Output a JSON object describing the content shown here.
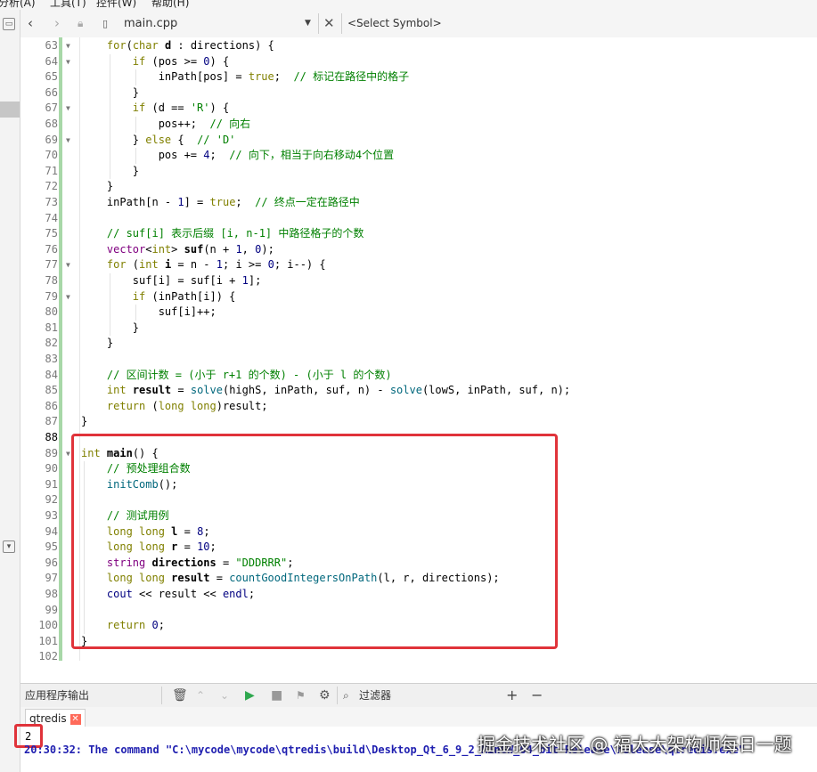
{
  "menu": [
    "分析(A)",
    "工具(T)",
    "控件(W)",
    "帮助(H)"
  ],
  "toolbar": {
    "file_name": "main.cpp",
    "symbol_placeholder": "<Select Symbol>"
  },
  "code_lines": [
    {
      "n": "63",
      "fold": true,
      "indent": 1,
      "tokens": [
        [
          "kw",
          "for"
        ],
        [
          "",
          "("
        ],
        [
          "kw",
          "char"
        ],
        [
          "",
          " "
        ],
        [
          "bd",
          "d"
        ],
        [
          "",
          " : directions) {"
        ]
      ]
    },
    {
      "n": "64",
      "fold": true,
      "indent": 2,
      "tokens": [
        [
          "kw",
          "if"
        ],
        [
          "",
          " (pos >= "
        ],
        [
          "nm",
          "0"
        ],
        [
          "",
          ") {"
        ]
      ]
    },
    {
      "n": "65",
      "fold": false,
      "indent": 3,
      "tokens": [
        [
          "",
          "inPath[pos] = "
        ],
        [
          "kw",
          "true"
        ],
        [
          "",
          ";  "
        ],
        [
          "cm",
          "// 标记在路径中的格子"
        ]
      ]
    },
    {
      "n": "66",
      "fold": false,
      "indent": 2,
      "tokens": [
        [
          "",
          "}"
        ]
      ]
    },
    {
      "n": "67",
      "fold": true,
      "indent": 2,
      "tokens": [
        [
          "kw",
          "if"
        ],
        [
          "",
          " (d == "
        ],
        [
          "st",
          "'R'"
        ],
        [
          "",
          ") {"
        ]
      ]
    },
    {
      "n": "68",
      "fold": false,
      "indent": 3,
      "tokens": [
        [
          "",
          "pos++;  "
        ],
        [
          "cm",
          "// 向右"
        ]
      ]
    },
    {
      "n": "69",
      "fold": true,
      "indent": 2,
      "tokens": [
        [
          "",
          "} "
        ],
        [
          "kw",
          "else"
        ],
        [
          "",
          " {  "
        ],
        [
          "cm",
          "// 'D'"
        ]
      ]
    },
    {
      "n": "70",
      "fold": false,
      "indent": 3,
      "tokens": [
        [
          "",
          "pos += "
        ],
        [
          "nm",
          "4"
        ],
        [
          "",
          ";  "
        ],
        [
          "cm",
          "// 向下，相当于向右移动4个位置"
        ]
      ]
    },
    {
      "n": "71",
      "fold": false,
      "indent": 2,
      "tokens": [
        [
          "",
          "}"
        ]
      ]
    },
    {
      "n": "72",
      "fold": false,
      "indent": 1,
      "tokens": [
        [
          "",
          "}"
        ]
      ]
    },
    {
      "n": "73",
      "fold": false,
      "indent": 1,
      "tokens": [
        [
          "",
          "inPath[n - "
        ],
        [
          "nm",
          "1"
        ],
        [
          "",
          "] = "
        ],
        [
          "kw",
          "true"
        ],
        [
          "",
          ";  "
        ],
        [
          "cm",
          "// 终点一定在路径中"
        ]
      ]
    },
    {
      "n": "74",
      "fold": false,
      "indent": 0,
      "tokens": []
    },
    {
      "n": "75",
      "fold": false,
      "indent": 1,
      "tokens": [
        [
          "cm",
          "// suf[i] 表示后缀 [i, n-1] 中路径格子的个数"
        ]
      ]
    },
    {
      "n": "76",
      "fold": false,
      "indent": 1,
      "tokens": [
        [
          "ty",
          "vector"
        ],
        [
          "",
          "<"
        ],
        [
          "kw",
          "int"
        ],
        [
          "",
          "> "
        ],
        [
          "bd",
          "suf"
        ],
        [
          "",
          "(n + "
        ],
        [
          "nm",
          "1"
        ],
        [
          "",
          ", "
        ],
        [
          "nm",
          "0"
        ],
        [
          "",
          ");"
        ]
      ]
    },
    {
      "n": "77",
      "fold": true,
      "indent": 1,
      "tokens": [
        [
          "kw",
          "for"
        ],
        [
          "",
          " ("
        ],
        [
          "kw",
          "int"
        ],
        [
          "",
          " "
        ],
        [
          "bd",
          "i"
        ],
        [
          "",
          " = n - "
        ],
        [
          "nm",
          "1"
        ],
        [
          "",
          "; i >= "
        ],
        [
          "nm",
          "0"
        ],
        [
          "",
          "; i--) {"
        ]
      ]
    },
    {
      "n": "78",
      "fold": false,
      "indent": 2,
      "tokens": [
        [
          "",
          "suf[i] = suf[i + "
        ],
        [
          "nm",
          "1"
        ],
        [
          "",
          "];"
        ]
      ]
    },
    {
      "n": "79",
      "fold": true,
      "indent": 2,
      "tokens": [
        [
          "kw",
          "if"
        ],
        [
          "",
          " (inPath[i]) {"
        ]
      ]
    },
    {
      "n": "80",
      "fold": false,
      "indent": 3,
      "tokens": [
        [
          "",
          "suf[i]++;"
        ]
      ]
    },
    {
      "n": "81",
      "fold": false,
      "indent": 2,
      "tokens": [
        [
          "",
          "}"
        ]
      ]
    },
    {
      "n": "82",
      "fold": false,
      "indent": 1,
      "tokens": [
        [
          "",
          "}"
        ]
      ]
    },
    {
      "n": "83",
      "fold": false,
      "indent": 0,
      "tokens": []
    },
    {
      "n": "84",
      "fold": false,
      "indent": 1,
      "tokens": [
        [
          "cm",
          "// 区间计数 = (小于 r+1 的个数) - (小于 l 的个数)"
        ]
      ]
    },
    {
      "n": "85",
      "fold": false,
      "indent": 1,
      "tokens": [
        [
          "kw",
          "int"
        ],
        [
          "",
          " "
        ],
        [
          "bd",
          "result"
        ],
        [
          "",
          " = "
        ],
        [
          "fn",
          "solve"
        ],
        [
          "",
          "(highS, inPath, suf, n) - "
        ],
        [
          "fn",
          "solve"
        ],
        [
          "",
          "(lowS, inPath, suf, n);"
        ]
      ]
    },
    {
      "n": "86",
      "fold": false,
      "indent": 1,
      "tokens": [
        [
          "kw",
          "return"
        ],
        [
          "",
          " ("
        ],
        [
          "kw",
          "long long"
        ],
        [
          "",
          ")result;"
        ]
      ]
    },
    {
      "n": "87",
      "fold": false,
      "indent": 0,
      "tokens": [
        [
          "",
          "}"
        ]
      ]
    },
    {
      "n": "88",
      "fold": false,
      "indent": 0,
      "current": true,
      "tokens": []
    },
    {
      "n": "89",
      "fold": true,
      "indent": 0,
      "tokens": [
        [
          "kw",
          "int"
        ],
        [
          "",
          " "
        ],
        [
          "bd",
          "main"
        ],
        [
          "",
          "() {"
        ]
      ]
    },
    {
      "n": "90",
      "fold": false,
      "indent": 1,
      "tokens": [
        [
          "cm",
          "// 预处理组合数"
        ]
      ]
    },
    {
      "n": "91",
      "fold": false,
      "indent": 1,
      "tokens": [
        [
          "fn",
          "initComb"
        ],
        [
          "",
          "();"
        ]
      ]
    },
    {
      "n": "92",
      "fold": false,
      "indent": 0,
      "tokens": []
    },
    {
      "n": "93",
      "fold": false,
      "indent": 1,
      "tokens": [
        [
          "cm",
          "// 测试用例"
        ]
      ]
    },
    {
      "n": "94",
      "fold": false,
      "indent": 1,
      "tokens": [
        [
          "kw",
          "long long"
        ],
        [
          "",
          " "
        ],
        [
          "bd",
          "l"
        ],
        [
          "",
          " = "
        ],
        [
          "nm",
          "8"
        ],
        [
          "",
          ";"
        ]
      ]
    },
    {
      "n": "95",
      "fold": false,
      "indent": 1,
      "tokens": [
        [
          "kw",
          "long long"
        ],
        [
          "",
          " "
        ],
        [
          "bd",
          "r"
        ],
        [
          "",
          " = "
        ],
        [
          "nm",
          "10"
        ],
        [
          "",
          ";"
        ]
      ]
    },
    {
      "n": "96",
      "fold": false,
      "indent": 1,
      "tokens": [
        [
          "ty",
          "string"
        ],
        [
          "",
          " "
        ],
        [
          "bd",
          "directions"
        ],
        [
          "",
          " = "
        ],
        [
          "st",
          "\"DDDRRR\""
        ],
        [
          "",
          ";"
        ]
      ]
    },
    {
      "n": "97",
      "fold": false,
      "indent": 1,
      "tokens": [
        [
          "kw",
          "long long"
        ],
        [
          "",
          " "
        ],
        [
          "bd",
          "result"
        ],
        [
          "",
          " = "
        ],
        [
          "fn",
          "countGoodIntegersOnPath"
        ],
        [
          "",
          "(l, r, directions);"
        ]
      ]
    },
    {
      "n": "98",
      "fold": false,
      "indent": 1,
      "tokens": [
        [
          "kb",
          "cout"
        ],
        [
          "",
          " << result << "
        ],
        [
          "kb",
          "endl"
        ],
        [
          "",
          ";"
        ]
      ]
    },
    {
      "n": "99",
      "fold": false,
      "indent": 0,
      "tokens": []
    },
    {
      "n": "100",
      "fold": false,
      "indent": 1,
      "tokens": [
        [
          "kw",
          "return"
        ],
        [
          "",
          " "
        ],
        [
          "nm",
          "0"
        ],
        [
          "",
          ";"
        ]
      ]
    },
    {
      "n": "101",
      "fold": false,
      "indent": 0,
      "tokens": [
        [
          "",
          "}"
        ]
      ]
    },
    {
      "n": "102",
      "fold": false,
      "indent": 0,
      "tokens": []
    }
  ],
  "output_panel": {
    "title": "应用程序输出",
    "filter_label": "过滤器",
    "tab_label": "qtredis",
    "output_value": "2",
    "command_line": "20:30:32: The command \"C:\\mycode\\mycode\\qtredis\\build\\Desktop_Qt_6_9_2_MinGW_64_bit-Release\\release\\qtredis.exe\""
  },
  "watermark": "掘金技术社区 @ 福大大架构师每日一题",
  "colors": {
    "highlight_box": "#e0333a",
    "keyword": "#808000",
    "comment": "#008000",
    "number": "#000080"
  }
}
